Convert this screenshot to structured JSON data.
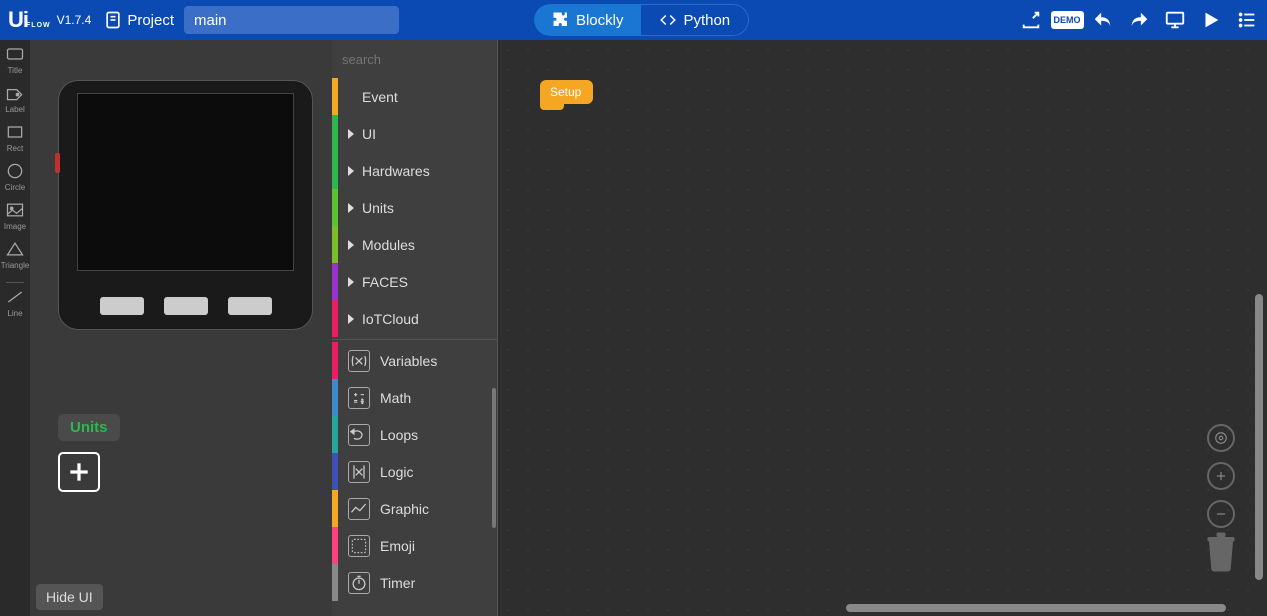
{
  "header": {
    "logo": "UiFLOW",
    "version": "V1.7.4",
    "project_label": "Project",
    "filename": "main",
    "tab_blockly": "Blockly",
    "tab_python": "Python",
    "demo_badge": "DEMO"
  },
  "left_tools": [
    {
      "id": "title",
      "label": "Title"
    },
    {
      "id": "label",
      "label": "Label"
    },
    {
      "id": "rect",
      "label": "Rect"
    },
    {
      "id": "circle",
      "label": "Circle"
    },
    {
      "id": "image",
      "label": "Image"
    },
    {
      "id": "triangle",
      "label": "Triangle"
    },
    {
      "id": "line",
      "label": "Line"
    }
  ],
  "ui_panel": {
    "units_label": "Units",
    "hide_ui": "Hide UI"
  },
  "search": {
    "placeholder": "search"
  },
  "categories_top": [
    {
      "id": "event",
      "label": "Event",
      "color": "#f5a623",
      "arrow": false
    },
    {
      "id": "ui",
      "label": "UI",
      "color": "#2db84d",
      "arrow": true
    },
    {
      "id": "hardwares",
      "label": "Hardwares",
      "color": "#2db84d",
      "arrow": true
    },
    {
      "id": "units",
      "label": "Units",
      "color": "#5bc234",
      "arrow": true
    },
    {
      "id": "modules",
      "label": "Modules",
      "color": "#7abf2a",
      "arrow": true
    },
    {
      "id": "faces",
      "label": "FACES",
      "color": "#9933cc",
      "arrow": true
    },
    {
      "id": "iotcloud",
      "label": "IoTCloud",
      "color": "#e91e63",
      "arrow": true
    }
  ],
  "categories_bottom": [
    {
      "id": "variables",
      "label": "Variables",
      "color": "#e91e63",
      "icon": "var"
    },
    {
      "id": "math",
      "label": "Math",
      "color": "#3f8ac9",
      "icon": "math"
    },
    {
      "id": "loops",
      "label": "Loops",
      "color": "#26a69a",
      "icon": "loop"
    },
    {
      "id": "logic",
      "label": "Logic",
      "color": "#3f51b5",
      "icon": "logic"
    },
    {
      "id": "graphic",
      "label": "Graphic",
      "color": "#f5a623",
      "icon": "graph"
    },
    {
      "id": "emoji",
      "label": "Emoji",
      "color": "#ff4081",
      "icon": "emoji"
    },
    {
      "id": "timer",
      "label": "Timer",
      "color": "#888",
      "icon": "timer"
    }
  ],
  "workspace": {
    "setup_block": "Setup"
  }
}
